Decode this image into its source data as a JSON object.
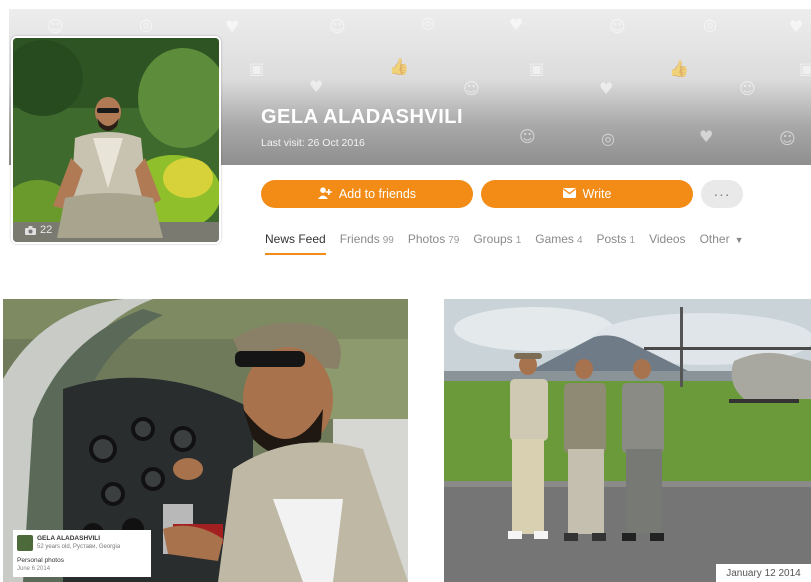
{
  "profile": {
    "name": "GELA ALADASHVILI",
    "last_visit": "Last visit: 26 Oct 2016",
    "photo_count": "22",
    "accent_color": "#f28c17"
  },
  "actions": {
    "add_friends": "Add to friends",
    "write": "Write",
    "more": "···"
  },
  "tabs": [
    {
      "label": "News Feed",
      "count": ""
    },
    {
      "label": "Friends",
      "count": "99"
    },
    {
      "label": "Photos",
      "count": "79"
    },
    {
      "label": "Groups",
      "count": "1"
    },
    {
      "label": "Games",
      "count": "4"
    },
    {
      "label": "Posts",
      "count": "1"
    },
    {
      "label": "Videos",
      "count": ""
    },
    {
      "label": "Other",
      "count": ""
    }
  ],
  "photo_left": {
    "caption_name": "GELA ALADASHVILI",
    "caption_info": "52 years old, Рустави, Georgia",
    "album": "Personal photos",
    "date": "June 6 2014"
  },
  "photo_right": {
    "date": "January 12 2014"
  },
  "icons": {
    "add_friend": "user-plus-icon",
    "write": "envelope-icon",
    "camera": "camera-icon"
  }
}
